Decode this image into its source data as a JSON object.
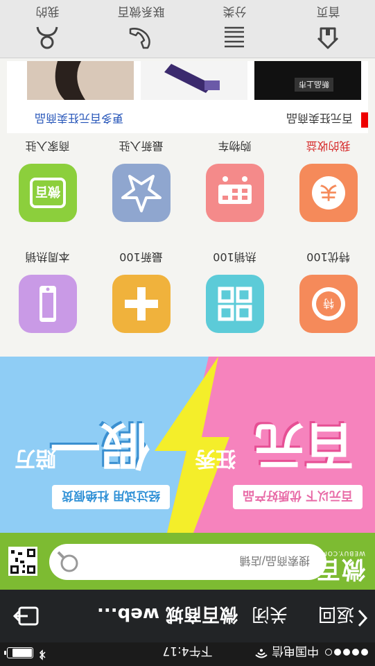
{
  "status_bar": {
    "carrier": "中国电信",
    "time": "下午4:17"
  },
  "nav_bar": {
    "back_label": "返回",
    "close_label": "关闭",
    "title": "微百商城 web..."
  },
  "search_header": {
    "logo_text": "微百",
    "logo_sub": "WEBUY.COM",
    "search_placeholder": "搜索商品/店铺"
  },
  "banner": {
    "left_tag": "百元以下 优质好产品",
    "left_big": "百元",
    "left_small": "狂秀",
    "right_tag": "经过试用 杜绝假货",
    "right_big": "假一",
    "right_small": "赔万"
  },
  "grid": {
    "items": [
      {
        "label": "特优100",
        "color": "#f58a5a",
        "icon": "special-offer-icon"
      },
      {
        "label": "热销100",
        "color": "#5ccbd8",
        "icon": "hot-sale-grid-icon"
      },
      {
        "label": "最新100",
        "color": "#f0b23c",
        "icon": "plus-icon"
      },
      {
        "label": "本周热销",
        "color": "#c99ae6",
        "icon": "phone-icon"
      },
      {
        "label": "我的收益",
        "color": "#f58a5a",
        "icon": "earnings-icon",
        "label_color": "red"
      },
      {
        "label": "购物车",
        "color": "#f48a8a",
        "icon": "cart-icon"
      },
      {
        "label": "最新入驻",
        "color": "#8fa6cf",
        "icon": "star-icon"
      },
      {
        "label": "商家入驻",
        "color": "#8ccf3c",
        "icon": "merchant-icon"
      }
    ]
  },
  "promo": {
    "title": "百元狂卖商品",
    "more": "更多百元狂卖商品",
    "thumb_label": "新品上市"
  },
  "tab_bar": {
    "tabs": [
      {
        "label": "首页",
        "icon": "home-icon"
      },
      {
        "label": "分类",
        "icon": "list-icon"
      },
      {
        "label": "联系微百",
        "icon": "phone-handset-icon"
      },
      {
        "label": "我的",
        "icon": "user-icon"
      }
    ]
  }
}
